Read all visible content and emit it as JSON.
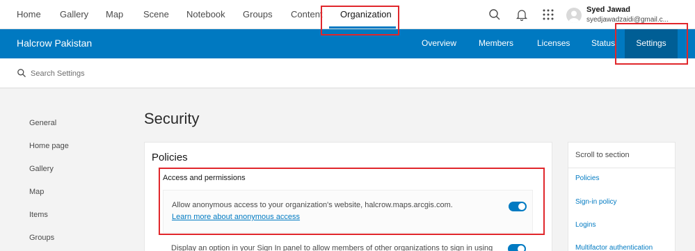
{
  "topnav": {
    "items": [
      {
        "label": "Home"
      },
      {
        "label": "Gallery"
      },
      {
        "label": "Map"
      },
      {
        "label": "Scene"
      },
      {
        "label": "Notebook"
      },
      {
        "label": "Groups"
      },
      {
        "label": "Content"
      },
      {
        "label": "Organization"
      }
    ],
    "active": "Organization",
    "icons": [
      "search-icon",
      "bell-icon",
      "app-launcher-icon"
    ],
    "user": {
      "name": "Syed Jawad",
      "email": "syedjawadzaidi@gmail.c..."
    }
  },
  "org": {
    "title": "Halcrow Pakistan",
    "tabs": [
      {
        "label": "Overview"
      },
      {
        "label": "Members"
      },
      {
        "label": "Licenses"
      },
      {
        "label": "Status"
      },
      {
        "label": "Settings"
      }
    ],
    "active_tab": "Settings"
  },
  "search": {
    "placeholder": "Search Settings"
  },
  "sidebar": {
    "items": [
      {
        "label": "General"
      },
      {
        "label": "Home page"
      },
      {
        "label": "Gallery"
      },
      {
        "label": "Map"
      },
      {
        "label": "Items"
      },
      {
        "label": "Groups"
      }
    ]
  },
  "page": {
    "title": "Security"
  },
  "policies": {
    "title": "Policies",
    "section_title": "Access and permissions",
    "anonymous_text": "Allow anonymous access to your organization's website, halcrow.maps.arcgis.com.",
    "anonymous_link": "Learn more about anonymous access",
    "anonymous_enabled": true,
    "signin_text": "Display an option in your Sign In panel to allow members of other organizations to sign in using",
    "signin_enabled": true
  },
  "scroll_to_section": {
    "title": "Scroll to section",
    "links": [
      {
        "label": "Policies"
      },
      {
        "label": "Sign-in policy"
      },
      {
        "label": "Logins"
      },
      {
        "label": "Multifactor authentication"
      }
    ]
  },
  "colors": {
    "brand_blue": "#0079c1",
    "active_tab": "#005e95",
    "link": "#007ac2",
    "highlight": "#e0262b"
  }
}
